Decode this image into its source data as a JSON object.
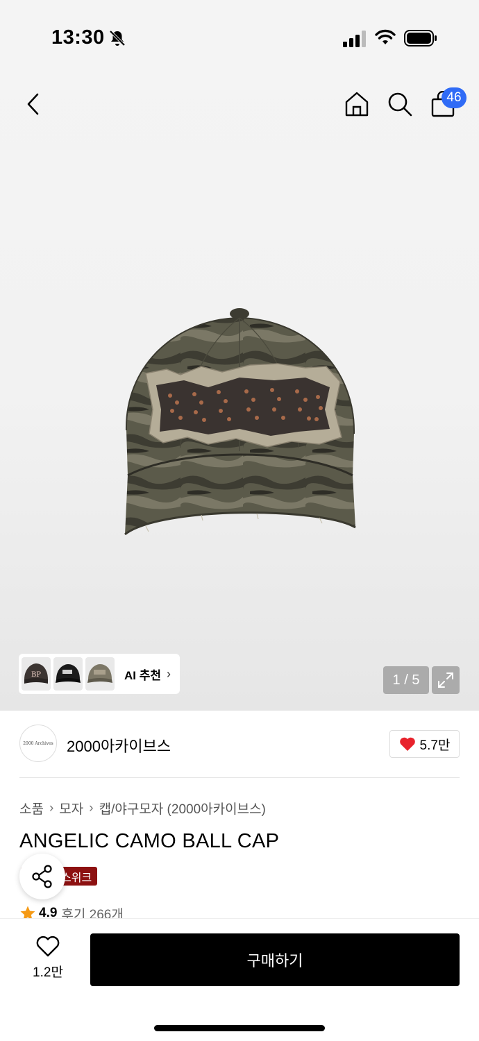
{
  "status_bar": {
    "time": "13:30"
  },
  "nav": {
    "cart_count": "46"
  },
  "gallery": {
    "ai_recommend_label": "AI 추천",
    "ai_arrow": "›",
    "counter": "1 / 5"
  },
  "brand": {
    "logo_text": "2000 Archives",
    "name": "2000아카이브스",
    "likes": "5.7만"
  },
  "breadcrumb": [
    "소품",
    "모자",
    "캡/야구모자 (2000아카이브스)"
  ],
  "breadcrumb_sep": "›",
  "product": {
    "title": "ANGELIC CAMO BALL CAP",
    "badge": "스위크",
    "rating": "4.9",
    "reviews": "후기 266개"
  },
  "bottom_bar": {
    "wish_count": "1.2만",
    "buy_label": "구매하기"
  },
  "colors": {
    "badge_bg": "#8d1111",
    "cart_badge_bg": "#2f6bf6",
    "heart": "#e8222c",
    "star": "#f59a16",
    "buy_bg": "#000000"
  }
}
